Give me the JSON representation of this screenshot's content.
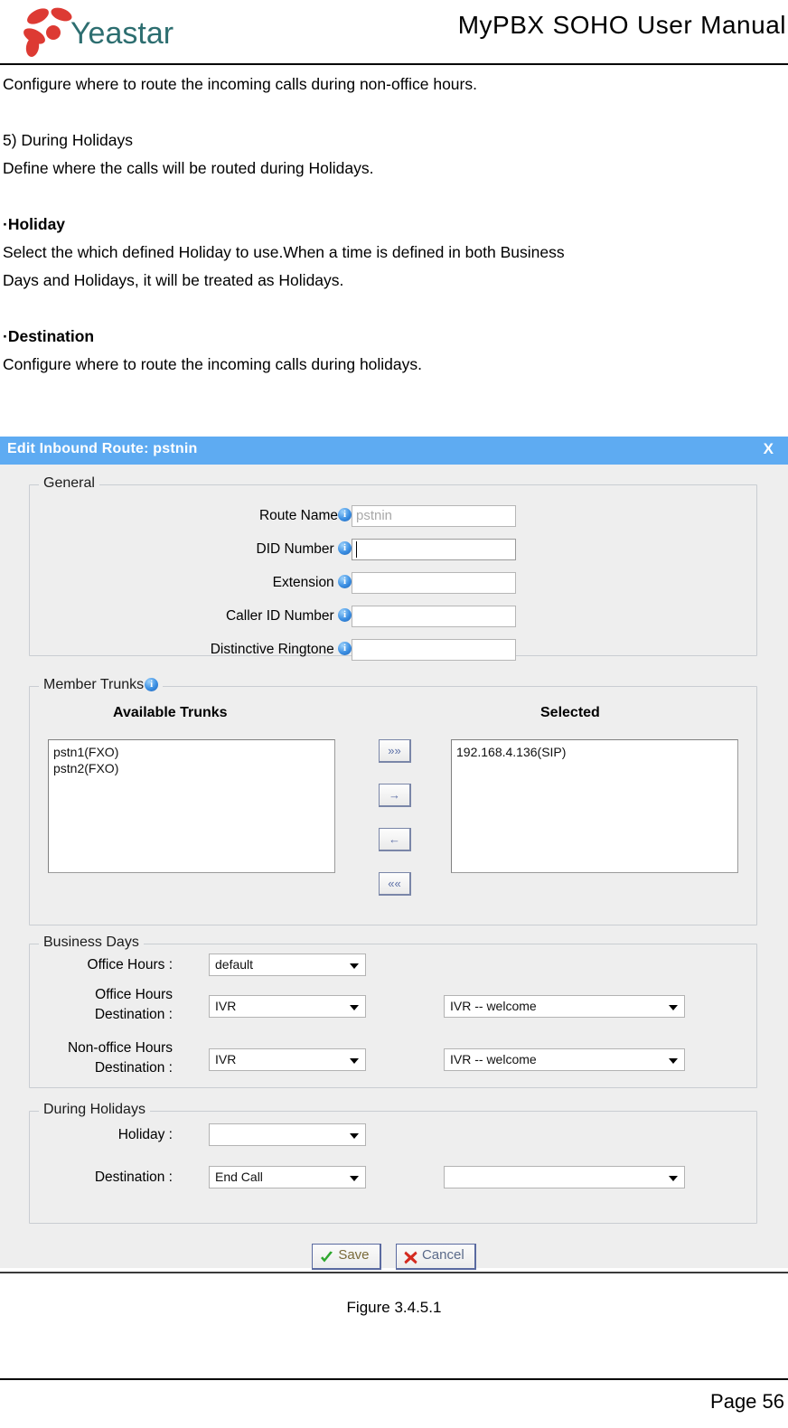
{
  "header": {
    "logo_text": "Yeastar",
    "manual_title_words": [
      "MyPBX",
      "SOHO",
      "User",
      "Manual"
    ],
    "logo_petal_color": "#dd3a33",
    "logo_text_color": "#2d6e70"
  },
  "document": {
    "intro_line": "Configure where to route the incoming calls during non-office hours.",
    "section_number": "5)  During Holidays",
    "section_desc": "Define where the calls will be routed during Holidays.",
    "holiday_heading": "·Holiday",
    "holiday_desc_line1": "Select the which defined Holiday to use.When a time is defined in both Business",
    "holiday_desc_line2": "Days and Holidays, it will be treated as Holidays.",
    "destination_heading": "·Destination",
    "destination_desc": "Configure where to route the incoming calls during holidays."
  },
  "dialog": {
    "title": "Edit Inbound Route: pstnin",
    "close_label": "X",
    "titlebar_color": "#5eabf2",
    "general": {
      "legend": "General",
      "fields": [
        {
          "label": "Route Name",
          "colon": ":",
          "value": "pstnin",
          "state": "disabled"
        },
        {
          "label": "DID Number",
          "colon": ":",
          "value": "",
          "state": "focused"
        },
        {
          "label": "Extension",
          "colon": ":",
          "value": "",
          "state": "normal"
        },
        {
          "label": "Caller ID Number",
          "colon": ":",
          "value": "",
          "state": "normal"
        },
        {
          "label": "Distinctive Ringtone",
          "colon": ":",
          "value": "",
          "state": "normal"
        }
      ]
    },
    "member_trunks": {
      "legend": "Member Trunks",
      "available_header": "Available Trunks",
      "selected_header": "Selected",
      "available": [
        "pstn1(FXO)",
        "pstn2(FXO)"
      ],
      "selected": [
        "192.168.4.136(SIP)"
      ],
      "transfer_buttons": [
        {
          "name": "move-all-right",
          "glyph": "»»"
        },
        {
          "name": "move-right",
          "glyph": "→"
        },
        {
          "name": "move-left",
          "glyph": "←"
        },
        {
          "name": "move-all-left",
          "glyph": "««"
        }
      ]
    },
    "business_days": {
      "legend": "Business Days",
      "office_hours_label": "Office Hours :",
      "office_hours_value": "default",
      "office_hours_dest_label": "Office Hours\nDestination :",
      "office_hours_dest_value": "IVR",
      "office_hours_dest_target": "IVR -- welcome",
      "non_office_hours_dest_label": "Non-office Hours\nDestination :",
      "non_office_hours_dest_value": "IVR",
      "non_office_hours_dest_target": "IVR -- welcome"
    },
    "during_holidays": {
      "legend": "During Holidays",
      "holiday_label": "Holiday :",
      "holiday_value": "",
      "destination_label": "Destination :",
      "destination_value": "End Call",
      "destination_target": ""
    },
    "actions": {
      "save_label": "Save",
      "cancel_label": "Cancel",
      "save_icon": "check-icon",
      "cancel_icon": "x-icon",
      "save_icon_color": "#2ea72e",
      "cancel_icon_color": "#d42b20"
    }
  },
  "figure": {
    "caption": "Figure 3.4.5.1"
  },
  "footer": {
    "page_number": "Page 56"
  }
}
